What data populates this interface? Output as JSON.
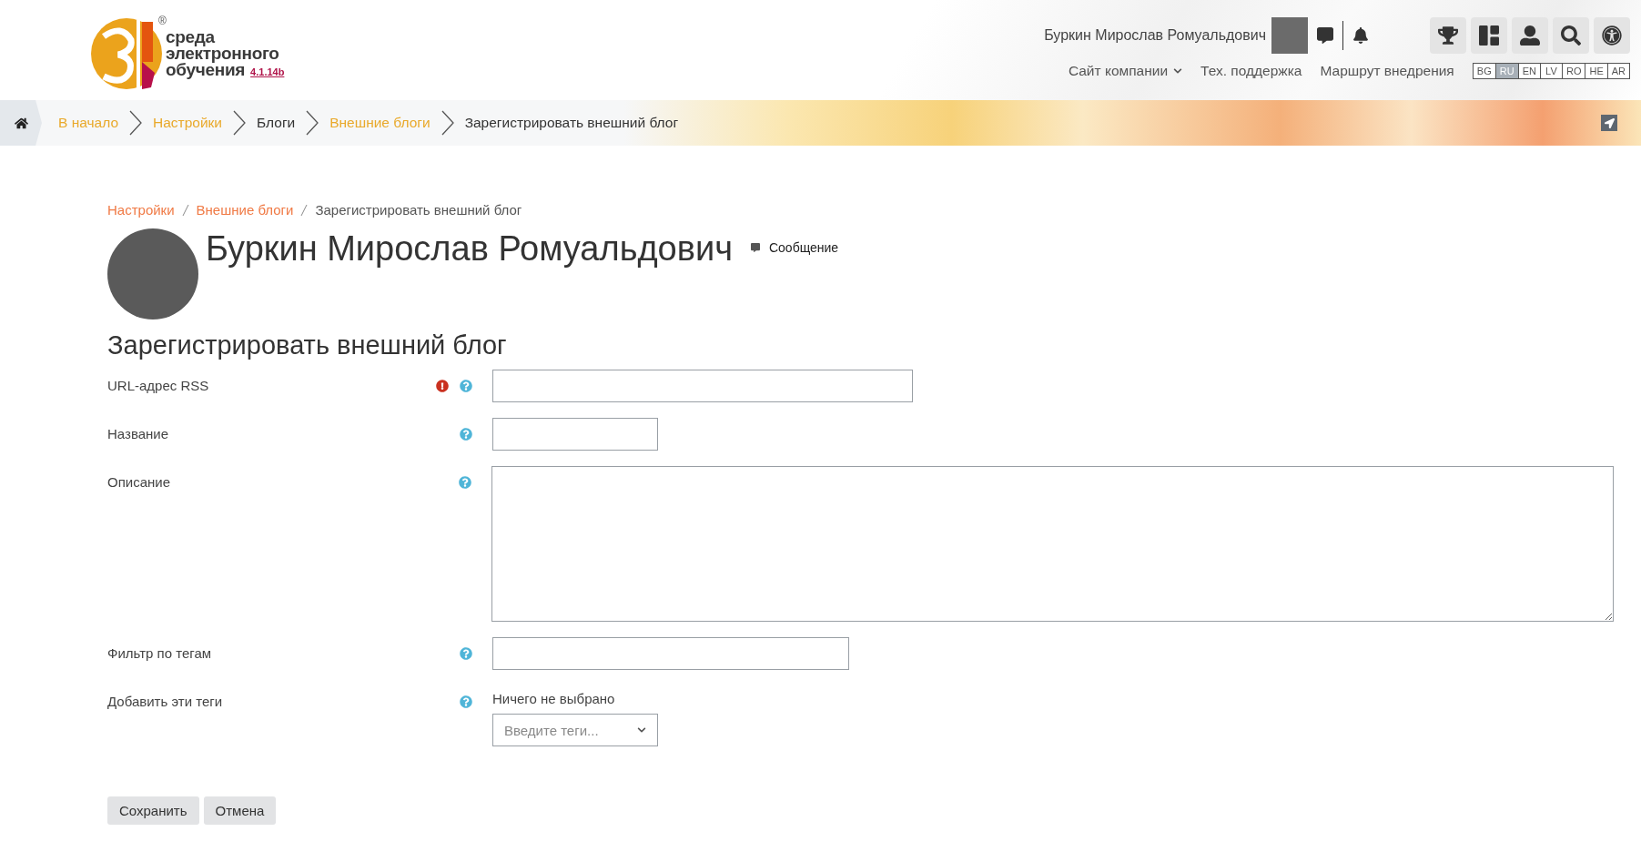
{
  "header": {
    "logo": {
      "lines": [
        "среда",
        "электронного",
        "обучения"
      ],
      "version": "4.1.14b",
      "mark": "®"
    },
    "user_name": "Буркин Мирослав Ромуальдович",
    "nav": [
      {
        "label": "Сайт компании",
        "dropdown": true
      },
      {
        "label": "Тех. поддержка",
        "dropdown": false
      },
      {
        "label": "Маршрут внедрения",
        "dropdown": false
      }
    ],
    "languages": [
      {
        "code": "BG",
        "selected": false
      },
      {
        "code": "RU",
        "selected": true
      },
      {
        "code": "EN",
        "selected": false
      },
      {
        "code": "LV",
        "selected": false
      },
      {
        "code": "RO",
        "selected": false
      },
      {
        "code": "HE",
        "selected": false
      },
      {
        "code": "AR",
        "selected": false
      }
    ]
  },
  "breadcrumb": [
    {
      "label": "В начало",
      "link": true
    },
    {
      "label": "Настройки",
      "link": true
    },
    {
      "label": "Блоги",
      "link": false
    },
    {
      "label": "Внешние блоги",
      "link": true
    },
    {
      "label": "Зарегистрировать внешний блог",
      "link": false
    }
  ],
  "page": {
    "breadcrumb": [
      {
        "label": "Настройки",
        "link": true
      },
      {
        "label": "Внешние блоги",
        "link": true
      },
      {
        "label": "Зарегистрировать внешний блог",
        "link": false
      }
    ],
    "profile": {
      "name": "Буркин Мирослав Ромуальдович",
      "message": "Сообщение"
    },
    "heading": "Зарегистрировать внешний блог",
    "fields": [
      {
        "kind": "long_input",
        "label": "URL-адрес RSS",
        "required": true
      },
      {
        "kind": "short_input",
        "label": "Название",
        "required": false
      },
      {
        "kind": "textarea",
        "label": "Описание",
        "required": false
      },
      {
        "kind": "medium_input",
        "label": "Фильтр по тегам",
        "required": false
      },
      {
        "kind": "tag_select",
        "label": "Добавить эти теги",
        "required": false,
        "status": "Ничего не выбрано",
        "placeholder": "Введите теги..."
      }
    ],
    "buttons": [
      "Сохранить",
      "Отмена"
    ]
  }
}
